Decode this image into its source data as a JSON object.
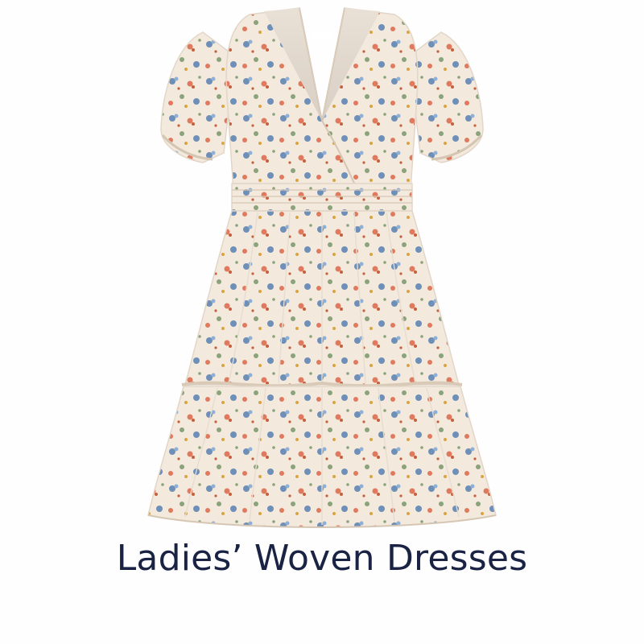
{
  "product": {
    "image_subject": "floral-v-neck-woven-dress",
    "caption": "Ladies’ Woven Dresses"
  },
  "colors": {
    "background": "#fefefe",
    "dress_base": "#f3e9dc",
    "floral_blue": "#6e8fb8",
    "floral_coral": "#e07a5f",
    "floral_rust": "#c4603c",
    "floral_green": "#8aa37a",
    "caption_text": "#1a2344"
  }
}
